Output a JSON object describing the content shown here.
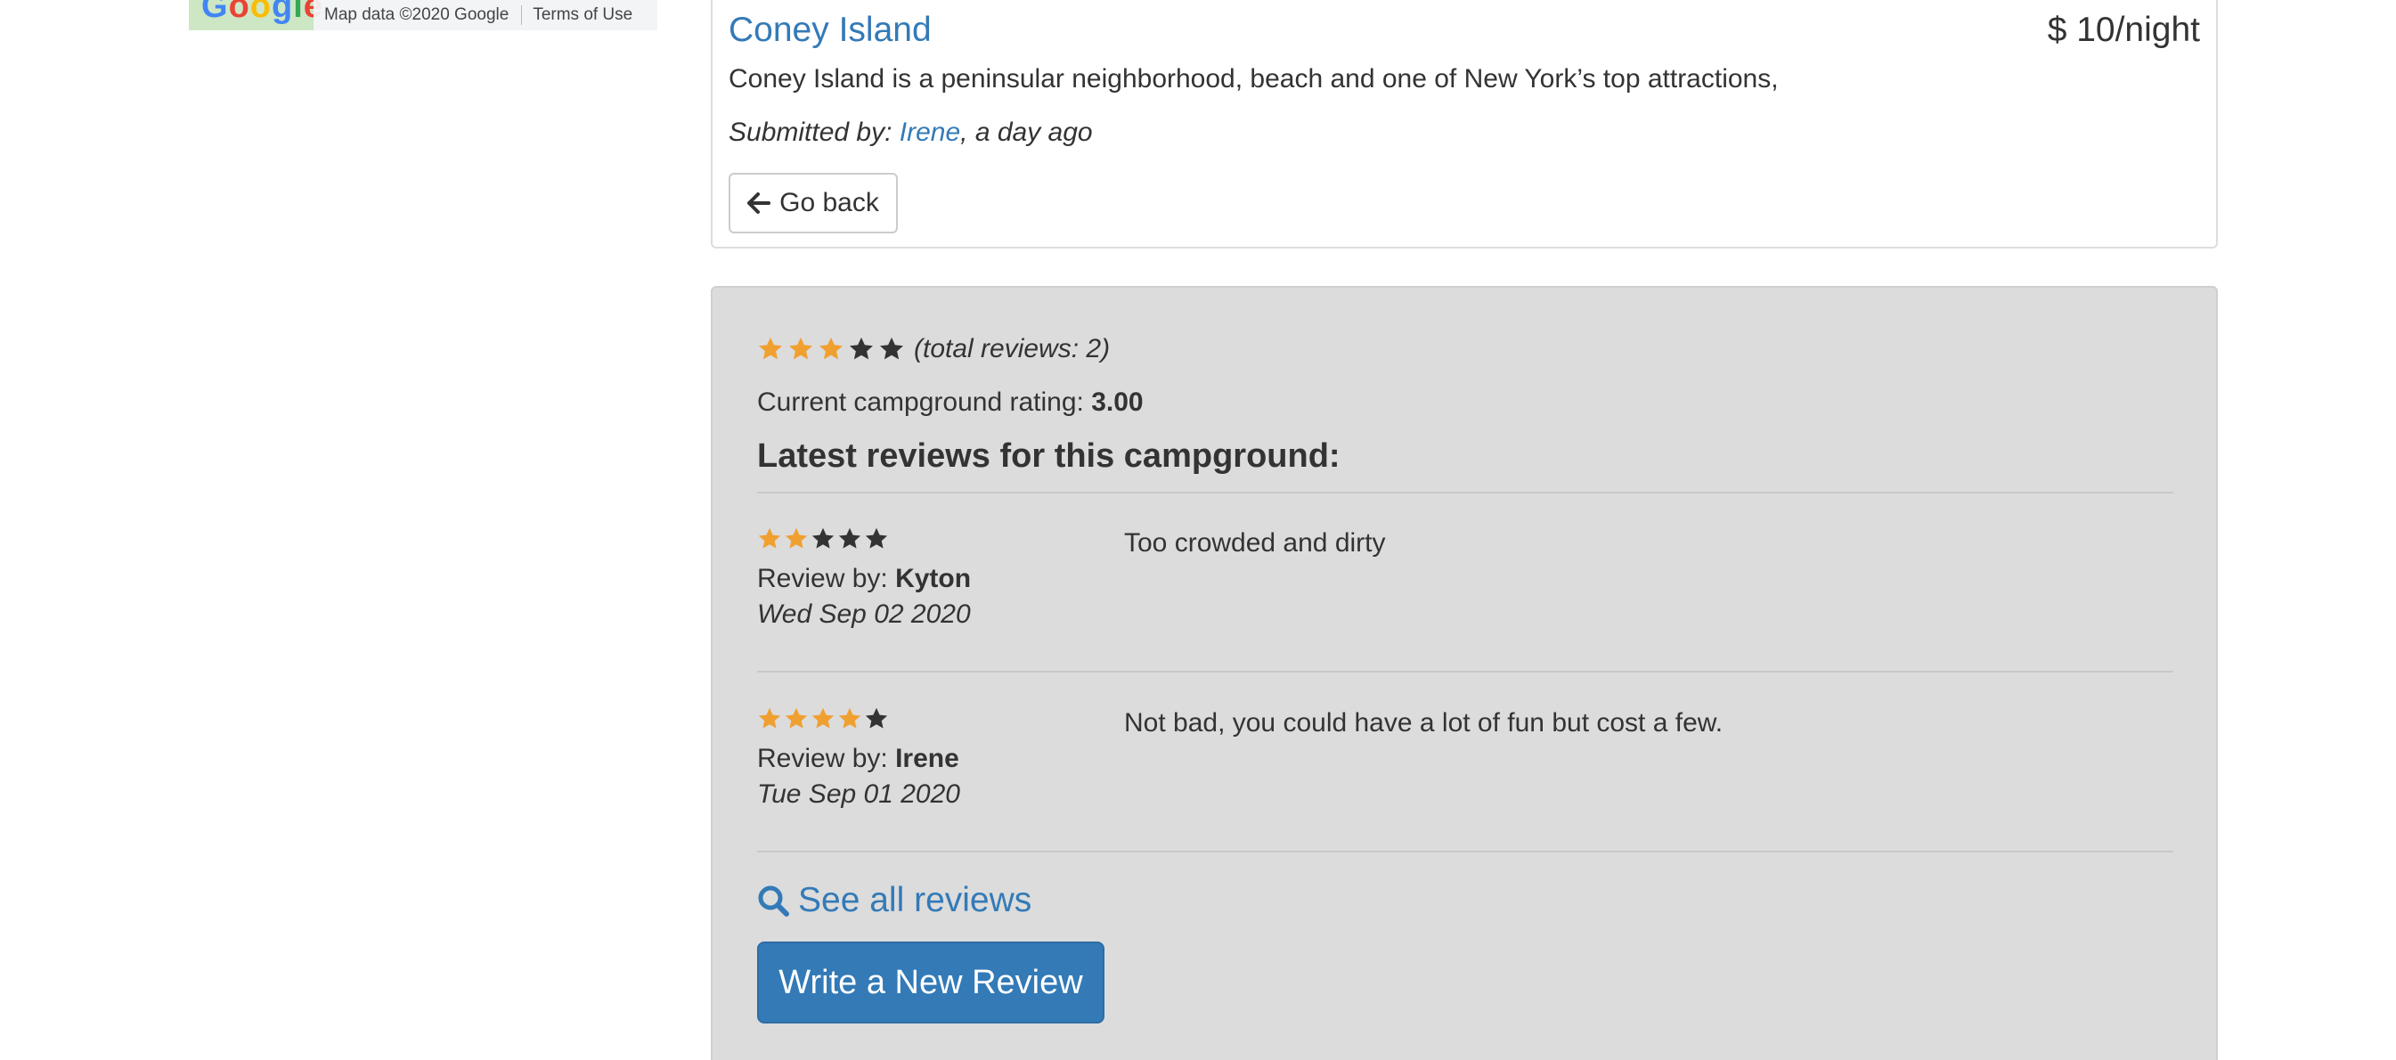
{
  "map": {
    "logo": "Google",
    "attribution": "Map data ©2020 Google",
    "terms": "Terms of Use"
  },
  "campground": {
    "name": "Coney Island",
    "price": "$ 10/night",
    "description": "Coney Island is a peninsular neighborhood, beach and one of New York’s top attractions,",
    "submitted_prefix": "Submitted by: ",
    "submitted_author": "Irene",
    "submitted_suffix": ", a day ago",
    "go_back_label": "Go back"
  },
  "reviews": {
    "summary_rating": 3,
    "summary_text": "(total reviews: 2)",
    "current_rating_label": "Current campground rating: ",
    "current_rating_value": "3.00",
    "heading": "Latest reviews for this campground:",
    "by_label": "Review by: ",
    "items": [
      {
        "rating": 2,
        "author": "Kyton",
        "date": "Wed Sep 02 2020",
        "text": "Too crowded and dirty"
      },
      {
        "rating": 4,
        "author": "Irene",
        "date": "Tue Sep 01 2020",
        "text": "Not bad, you could have a lot of fun but cost a few."
      }
    ],
    "see_all_label": "See all reviews",
    "write_label": "Write a New Review"
  },
  "colors": {
    "link": "#337ab7",
    "star_filled": "#f0a030",
    "star_empty": "#333333",
    "well_bg": "#dcdcdc"
  },
  "icons": {
    "go_back": "arrow-left-icon",
    "see_all": "search-icon",
    "star": "star-icon"
  }
}
